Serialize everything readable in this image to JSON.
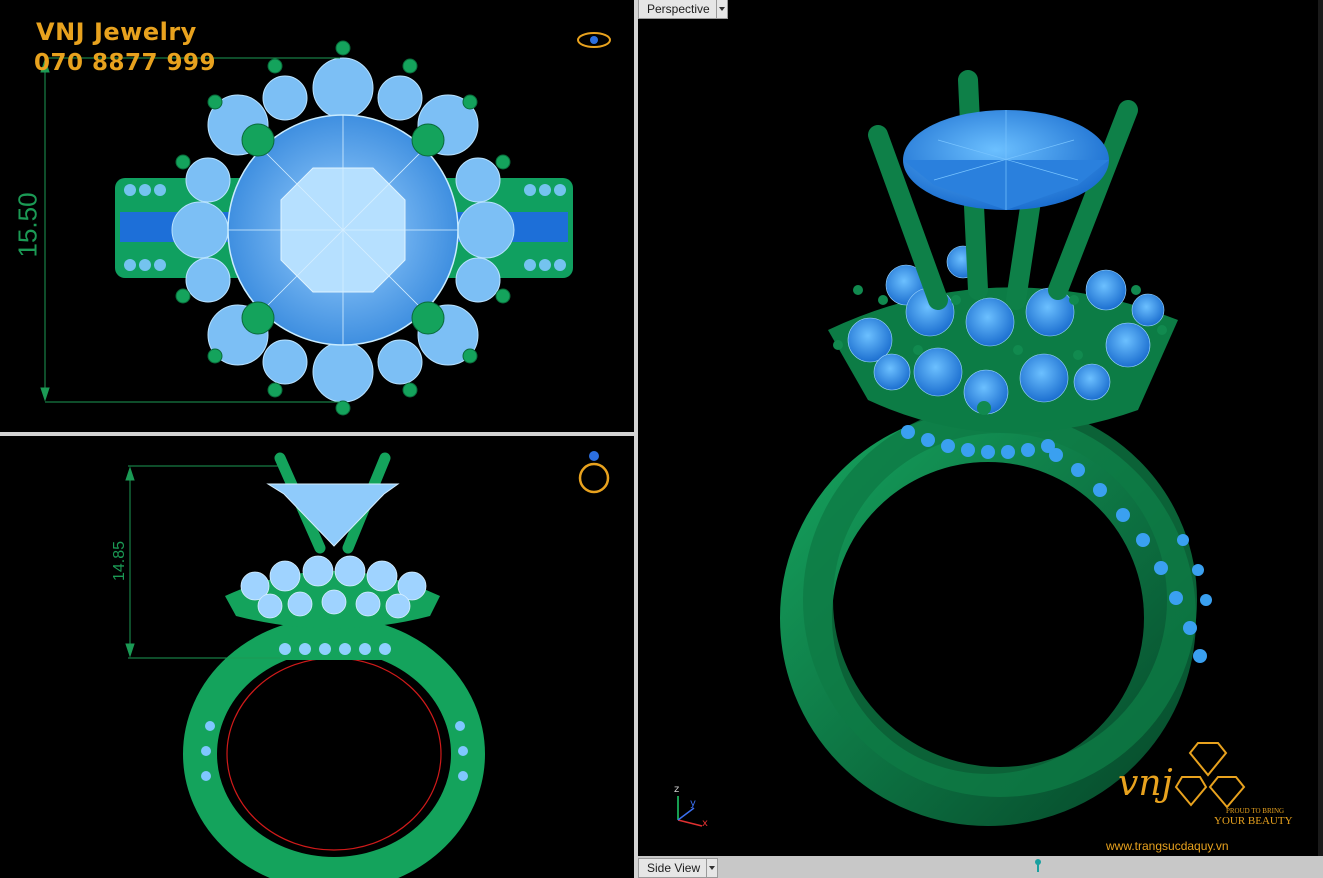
{
  "brand": {
    "name": "VNJ Jewelry",
    "phone": "070 8877 999"
  },
  "top_view": {
    "dimension": "15.50"
  },
  "front_view": {
    "dimension": "14.85"
  },
  "perspective_view": {
    "tab_label": "Perspective",
    "axis_labels": {
      "z": "z",
      "y": "y",
      "x": "x"
    }
  },
  "bottom_tab": {
    "label": "Side View"
  },
  "watermark": {
    "logo": "vnj",
    "tagline_1": "PROUD TO BRING",
    "tagline_2": "YOUR BEAUTY",
    "url": "www.trangsucdaquy.vn"
  },
  "colors": {
    "metal": "#0d8f52",
    "metal_dark": "#0a5a35",
    "gem": "#3aa0f0",
    "dim_line": "#1b9a55",
    "brand": "#e8a21e"
  }
}
